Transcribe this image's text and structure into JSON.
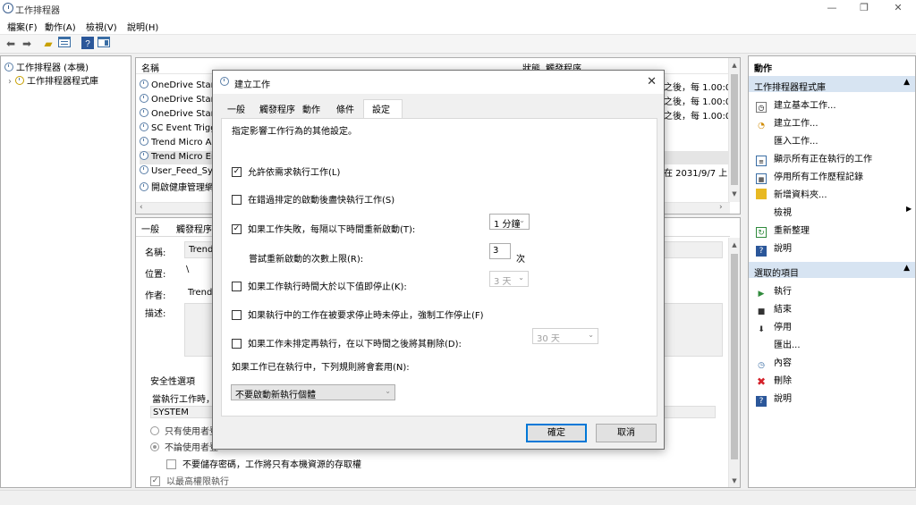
{
  "window": {
    "title": "工作排程器",
    "minimize": "—",
    "maximize": "❐",
    "close": "✕"
  },
  "menu": [
    "檔案(F)",
    "動作(A)",
    "檢視(V)",
    "說明(H)"
  ],
  "tree": {
    "root": "工作排程器 (本機)",
    "child": "工作排程器程式庫"
  },
  "list": {
    "col_name": "名稱",
    "col_status": "狀態",
    "col_trigger": "觸發程序",
    "rows": [
      {
        "name": "OneDrive Stand",
        "trigger": "之後，每 1.00:0C"
      },
      {
        "name": "OneDrive Stand",
        "trigger": "之後，每 1.00:0C"
      },
      {
        "name": "OneDrive Stand",
        "trigger": "之後，每 1.00:0C"
      },
      {
        "name": "SC Event Trigge",
        "trigger": ""
      },
      {
        "name": "Trend Micro Ap",
        "trigger": ""
      },
      {
        "name": "Trend Micro Enc",
        "trigger": ""
      },
      {
        "name": "User_Feed_Sync",
        "trigger": "在 2031/9/7 上"
      },
      {
        "name": "開啟健康管理網",
        "trigger": ""
      }
    ]
  },
  "props": {
    "tabs": [
      "一般",
      "觸發程序"
    ],
    "name_label": "名稱:",
    "name_value": "Trend I",
    "location_label": "位置:",
    "location_value": "\\",
    "author_label": "作者:",
    "author_value": "Trend",
    "desc_label": "描述:",
    "security_title": "安全性選項",
    "security_run_as": "當執行工作時，",
    "security_user": "SYSTEM",
    "radio_logged_on": "只有使用者登",
    "radio_whether": "不論使用者登",
    "no_store_pw": "不要儲存密碼，工作將只有本機資源的存取權",
    "highest": "以最高權限執行"
  },
  "actions": {
    "header": "動作",
    "section1": "工作排程器程式庫",
    "items1": [
      {
        "icon": "basic-task-icon",
        "label": "建立基本工作..."
      },
      {
        "icon": "create-task-icon",
        "label": "建立工作..."
      },
      {
        "icon": "",
        "label": "匯入工作..."
      },
      {
        "icon": "running-tasks-icon",
        "label": "顯示所有正在執行的工作"
      },
      {
        "icon": "history-icon",
        "label": "停用所有工作歷程記錄"
      },
      {
        "icon": "folder-icon",
        "label": "新增資料夾..."
      },
      {
        "icon": "",
        "label": "檢視"
      },
      {
        "icon": "refresh-icon",
        "label": "重新整理"
      },
      {
        "icon": "help-icon",
        "label": "說明"
      }
    ],
    "section2": "選取的項目",
    "items2": [
      {
        "icon": "run-icon",
        "label": "執行"
      },
      {
        "icon": "end-icon",
        "label": "結束"
      },
      {
        "icon": "disable-icon",
        "label": "停用"
      },
      {
        "icon": "",
        "label": "匯出..."
      },
      {
        "icon": "properties-icon",
        "label": "內容"
      },
      {
        "icon": "delete-icon",
        "label": "刪除"
      },
      {
        "icon": "help-icon",
        "label": "說明"
      }
    ]
  },
  "dialog": {
    "title": "建立工作",
    "tabs": [
      "一般",
      "觸發程序",
      "動作",
      "條件",
      "設定"
    ],
    "active_tab": "設定",
    "intro": "指定影響工作行為的其他設定。",
    "allow_demand": "允許依需求執行工作(L)",
    "run_after_missed": "在錯過排定的啟動後盡快執行工作(S)",
    "restart_on_fail": "如果工作失敗，每隔以下時間重新啟動(T):",
    "restart_interval": "1 分鐘",
    "restart_attempts_label": "嘗試重新啟動的次數上限(R):",
    "restart_attempts": "3",
    "restart_attempts_unit": "次",
    "stop_if_longer": "如果工作執行時間大於以下值即停止(K):",
    "stop_duration": "3 天",
    "force_stop": "如果執行中的工作在被要求停止時未停止，強制工作停止(F)",
    "delete_if_not_scheduled": "如果工作未排定再執行，在以下時間之後將其刪除(D):",
    "delete_after": "30 天",
    "already_running_label": "如果工作已在執行中，下列規則將會套用(N):",
    "already_running_rule": "不要啟動新執行個體",
    "ok": "確定",
    "cancel": "取消"
  }
}
